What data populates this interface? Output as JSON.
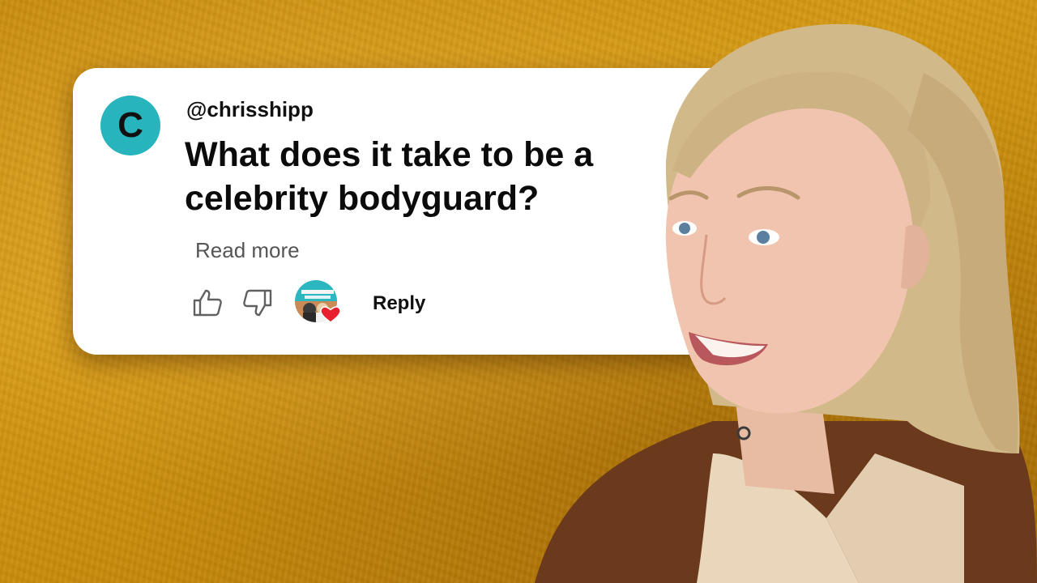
{
  "comment": {
    "avatar_letter": "C",
    "avatar_color": "#27b4bd",
    "handle": "@chrisshipp",
    "text_line1": "What does it take to be a",
    "text_line2": "celebrity bodyguard?",
    "read_more": "Read more",
    "reply": "Reply",
    "icons": [
      "thumbs-up-icon",
      "thumbs-down-icon",
      "creator-heart-icon"
    ]
  },
  "colors": {
    "background": "#d09412",
    "card": "#ffffff",
    "heart": "#e8202e"
  }
}
